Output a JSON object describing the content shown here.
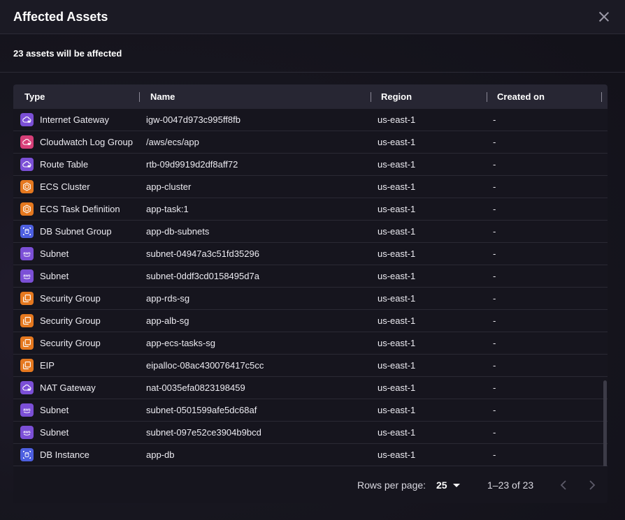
{
  "dialog": {
    "title": "Affected Assets",
    "subtitle": "23 assets will be affected"
  },
  "table": {
    "columns": [
      "Type",
      "Name",
      "Region",
      "Created on"
    ],
    "rows": [
      {
        "type": "Internet Gateway",
        "icon": "cloud-lock-icon",
        "color": "#7b4fd6",
        "name": "igw-0047d973c995ff8fb",
        "region": "us-east-1",
        "created": "-"
      },
      {
        "type": "Cloudwatch Log Group",
        "icon": "cloud-lock-icon",
        "color": "#d63f78",
        "name": "/aws/ecs/app",
        "region": "us-east-1",
        "created": "-"
      },
      {
        "type": "Route Table",
        "icon": "cloud-lock-icon",
        "color": "#7b4fd6",
        "name": "rtb-09d9919d2df8aff72",
        "region": "us-east-1",
        "created": "-"
      },
      {
        "type": "ECS Cluster",
        "icon": "hexagon-icon",
        "color": "#e5781f",
        "name": "app-cluster",
        "region": "us-east-1",
        "created": "-"
      },
      {
        "type": "ECS Task Definition",
        "icon": "hexagon-icon",
        "color": "#e5781f",
        "name": "app-task:1",
        "region": "us-east-1",
        "created": "-"
      },
      {
        "type": "DB Subnet Group",
        "icon": "database-icon",
        "color": "#4d5fe0",
        "name": "app-db-subnets",
        "region": "us-east-1",
        "created": "-"
      },
      {
        "type": "Subnet",
        "icon": "aws-icon",
        "color": "#7b4fd6",
        "name": "subnet-04947a3c51fd35296",
        "region": "us-east-1",
        "created": "-"
      },
      {
        "type": "Subnet",
        "icon": "aws-icon",
        "color": "#7b4fd6",
        "name": "subnet-0ddf3cd0158495d7a",
        "region": "us-east-1",
        "created": "-"
      },
      {
        "type": "Security Group",
        "icon": "copy-icon",
        "color": "#e5781f",
        "name": "app-rds-sg",
        "region": "us-east-1",
        "created": "-"
      },
      {
        "type": "Security Group",
        "icon": "copy-icon",
        "color": "#e5781f",
        "name": "app-alb-sg",
        "region": "us-east-1",
        "created": "-"
      },
      {
        "type": "Security Group",
        "icon": "copy-icon",
        "color": "#e5781f",
        "name": "app-ecs-tasks-sg",
        "region": "us-east-1",
        "created": "-"
      },
      {
        "type": "EIP",
        "icon": "copy-icon",
        "color": "#e5781f",
        "name": "eipalloc-08ac430076417c5cc",
        "region": "us-east-1",
        "created": "-"
      },
      {
        "type": "NAT Gateway",
        "icon": "cloud-lock-icon",
        "color": "#7b4fd6",
        "name": "nat-0035efa0823198459",
        "region": "us-east-1",
        "created": "-"
      },
      {
        "type": "Subnet",
        "icon": "aws-icon",
        "color": "#7b4fd6",
        "name": "subnet-0501599afe5dc68af",
        "region": "us-east-1",
        "created": "-"
      },
      {
        "type": "Subnet",
        "icon": "aws-icon",
        "color": "#7b4fd6",
        "name": "subnet-097e52ce3904b9bcd",
        "region": "us-east-1",
        "created": "-"
      },
      {
        "type": "DB Instance",
        "icon": "database-icon",
        "color": "#4d5fe0",
        "name": "app-db",
        "region": "us-east-1",
        "created": "-"
      }
    ]
  },
  "pagination": {
    "rows_per_page_label": "Rows per page:",
    "rows_per_page_value": "25",
    "range_text": "1–23 of 23"
  }
}
